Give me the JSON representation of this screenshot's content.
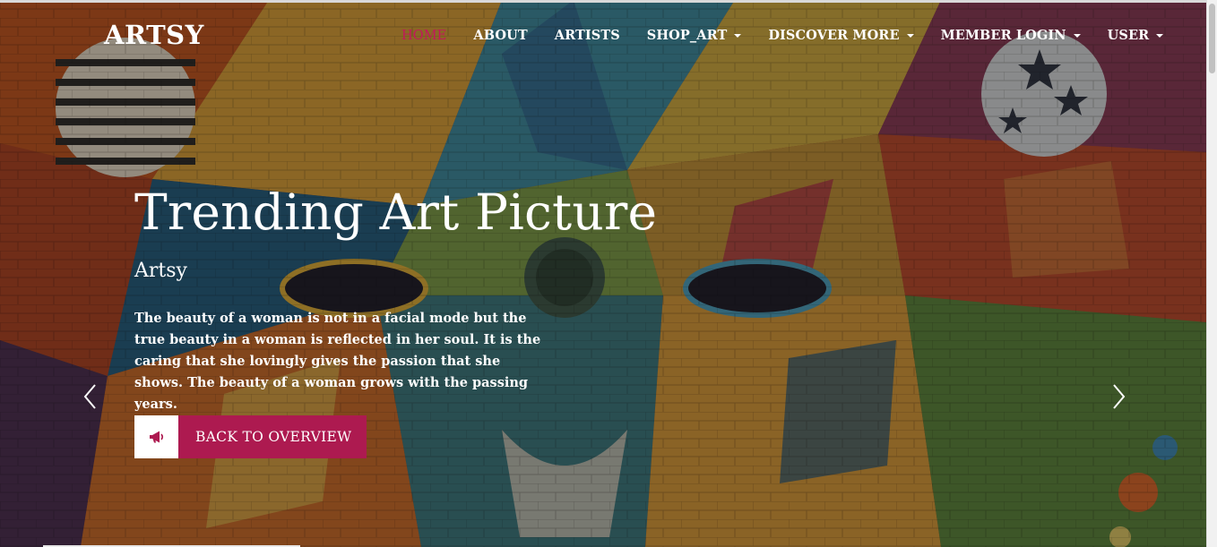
{
  "brand": {
    "name": "ARTSY"
  },
  "nav": {
    "items": [
      {
        "label": "HOME",
        "active": true,
        "dropdown": false
      },
      {
        "label": "ABOUT",
        "active": false,
        "dropdown": false
      },
      {
        "label": "ARTISTS",
        "active": false,
        "dropdown": false
      },
      {
        "label": "SHOP_ART",
        "active": false,
        "dropdown": true
      },
      {
        "label": "DISCOVER MORE",
        "active": false,
        "dropdown": true
      },
      {
        "label": "MEMBER LOGIN",
        "active": false,
        "dropdown": true
      },
      {
        "label": "USER",
        "active": false,
        "dropdown": true
      }
    ]
  },
  "hero": {
    "title": "Trending Art Picture",
    "subtitle": "Artsy",
    "text": "The beauty of a woman is not in a facial mode but the true beauty in a woman is reflected in her soul. It is the caring that she lovingly gives the passion that she shows. The beauty of a woman grows with the passing years.",
    "cta": {
      "label": "BACK TO OVERVIEW",
      "icon": "megaphone-icon"
    }
  },
  "carousel": {
    "prev_icon": "chevron-left-icon",
    "next_icon": "chevron-right-icon"
  },
  "colors": {
    "accent": "#ad1a50",
    "nav_active": "#c2185b",
    "text": "#ffffff"
  }
}
